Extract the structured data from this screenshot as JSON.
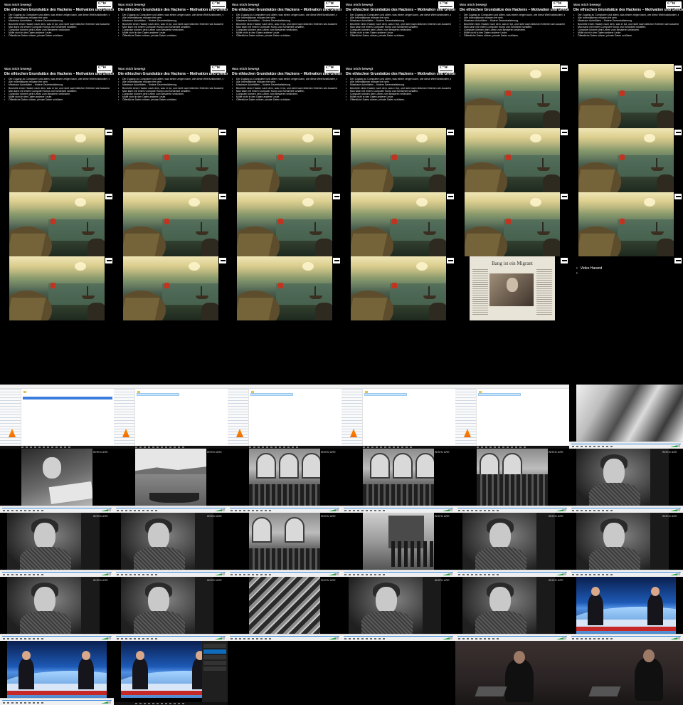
{
  "slide": {
    "kicker": "Was mich bewegt",
    "title": "Die ethischen Grundsätze des Hackens – Motivation und Grenzen:",
    "bullets": [
      "Der Zugang zu Computern und allem, was einem zeigen kann, wie diese Welt funktioniert, sollte unbegrenzt und vollständig sein.",
      "Alle Informationen müssen frei sein.",
      "Misstraue Autoritäten – fördere Dezentralisierung.",
      "Beurteile einen Hacker nach dem, was er tut, und nicht nach üblichen Kriterien wie Aussehen, Alter, Herkunft, Spezies, Geschlecht oder gesellschaftliche Stellung.",
      "Man kann mit einem Computer Kunst und Schönheit schaffen.",
      "Computer können dein Leben zum Besseren verändern.",
      "Mülle nicht in den Daten anderer Leute.",
      "Öffentliche Daten nützen, private Daten schützen."
    ]
  },
  "newspaper": {
    "headline": "Bang ist ein Migrant"
  },
  "slide_list": {
    "items": [
      "Video Harand",
      ""
    ]
  },
  "player": {
    "watermark": "WHEN ARE"
  }
}
